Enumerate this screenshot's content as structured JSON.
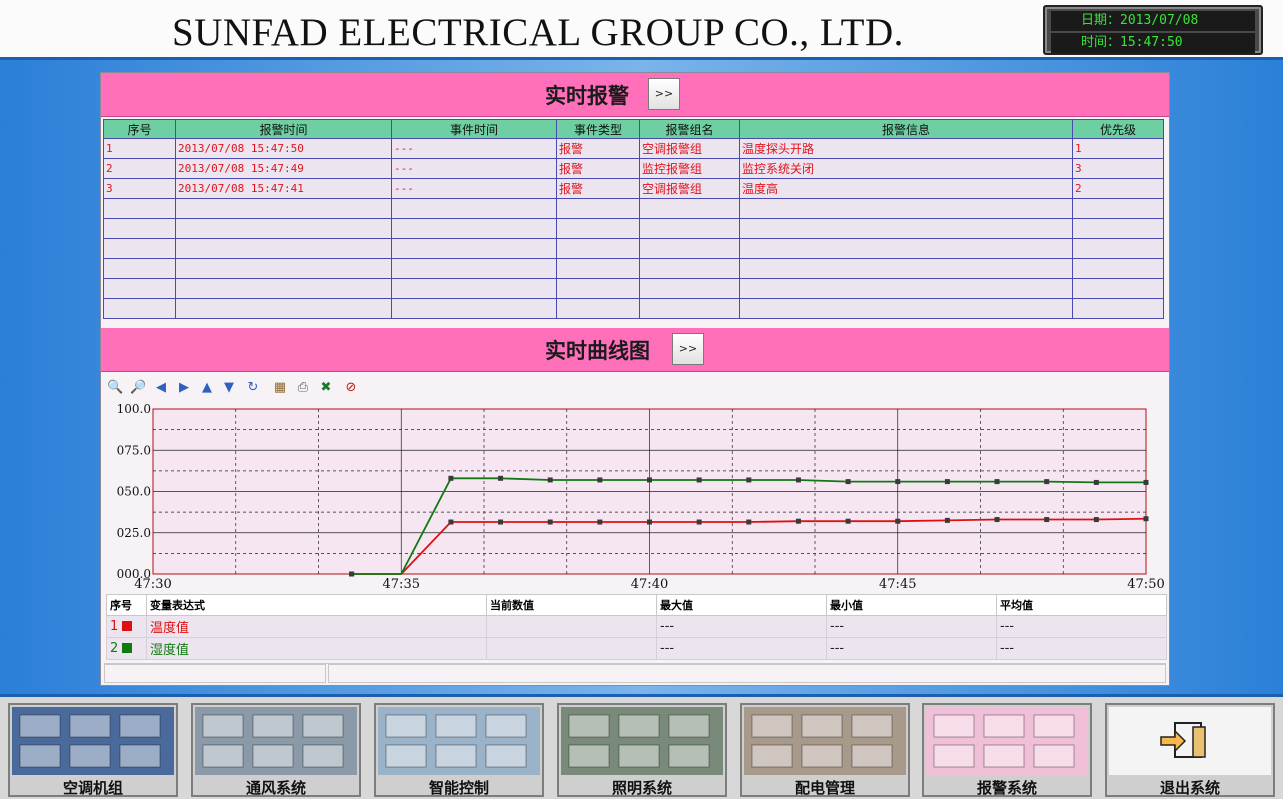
{
  "header": {
    "company": "SUNFAD ELECTRICAL GROUP CO., LTD.",
    "date_text": "日期：2013/07/08",
    "time_text": "时间：15:47:50",
    "clock_color": "#38e43a"
  },
  "alarm_section": {
    "title": "实时报警",
    "expand_label": ">>",
    "columns": [
      "序号",
      "报警时间",
      "事件时间",
      "事件类型",
      "报警组名",
      "报警信息",
      "优先级"
    ],
    "rows": [
      [
        "1",
        "2013/07/08 15:47:50",
        "---",
        "报警",
        "空调报警组",
        "温度探头开路",
        "1"
      ],
      [
        "2",
        "2013/07/08 15:47:49",
        "---",
        "报警",
        "监控报警组",
        "监控系统关闭",
        "3"
      ],
      [
        "3",
        "2013/07/08 15:47:41",
        "---",
        "报警",
        "空调报警组",
        "温度高",
        "2"
      ]
    ],
    "empty_rows": 6,
    "accent": "#ff6fba",
    "header_color": "#6ecfa2",
    "text_color": "#e0141e"
  },
  "trend_section": {
    "title": "实时曲线图",
    "expand_label": ">>",
    "toolbar_icons": [
      "zoom-in-icon",
      "zoom-out-icon",
      "arrow-left-icon",
      "arrow-right-icon",
      "arrow-up-icon",
      "arrow-down-icon",
      "refresh-icon",
      "properties-icon",
      "print-icon",
      "excel-export-icon",
      "stop-icon"
    ],
    "legend_columns": [
      "序号",
      "变量表达式",
      "当前数值",
      "最大值",
      "最小值",
      "平均值"
    ],
    "legend_rows": [
      {
        "index": "1",
        "name": "温度值",
        "current": "",
        "max": "---",
        "min": "---",
        "avg": "---",
        "color": "#e01010"
      },
      {
        "index": "2",
        "name": "湿度值",
        "current": "",
        "max": "---",
        "min": "---",
        "avg": "---",
        "color": "#107a10"
      }
    ]
  },
  "chart_data": {
    "type": "line",
    "x_tick_labels": [
      "47:30",
      "47:35",
      "47:40",
      "47:45",
      "47:50"
    ],
    "y_tick_labels": [
      "100.0",
      "075.0",
      "050.0",
      "025.0",
      "000.0"
    ],
    "xlim": [
      0,
      20
    ],
    "ylim": [
      0,
      100
    ],
    "grid": true,
    "series": [
      {
        "name": "温度值",
        "color": "#e01010",
        "x": [
          4,
          5,
          6,
          7,
          8,
          9,
          10,
          11,
          12,
          13,
          14,
          15,
          16,
          17,
          18,
          19,
          20
        ],
        "y": [
          0,
          0,
          31.5,
          31.5,
          31.5,
          31.5,
          31.5,
          31.5,
          31.5,
          32,
          32,
          32,
          32.5,
          33,
          33,
          33,
          33.5
        ]
      },
      {
        "name": "湿度值",
        "color": "#107a10",
        "x": [
          4,
          5,
          6,
          7,
          8,
          9,
          10,
          11,
          12,
          13,
          14,
          15,
          16,
          17,
          18,
          19,
          20
        ],
        "y": [
          0,
          0,
          58,
          58,
          57,
          57,
          57,
          57,
          57,
          57,
          56,
          56,
          56,
          56,
          56,
          55.5,
          55.5
        ]
      }
    ]
  },
  "nav": {
    "items": [
      {
        "label": "空调机组",
        "name": "nav-hvac-unit",
        "theme": "#4b6a9c"
      },
      {
        "label": "通风系统",
        "name": "nav-ventilation",
        "theme": "#8a9aa8"
      },
      {
        "label": "智能控制",
        "name": "nav-smart-control",
        "theme": "#9bb3c9"
      },
      {
        "label": "照明系统",
        "name": "nav-lighting",
        "theme": "#7a8a7a"
      },
      {
        "label": "配电管理",
        "name": "nav-power-distribution",
        "theme": "#a89a8a"
      },
      {
        "label": "报警系统",
        "name": "nav-alarm-system",
        "theme": "#f0c0d8"
      },
      {
        "label": "退出系统",
        "name": "nav-exit",
        "theme": "#f4f4f4"
      }
    ]
  }
}
